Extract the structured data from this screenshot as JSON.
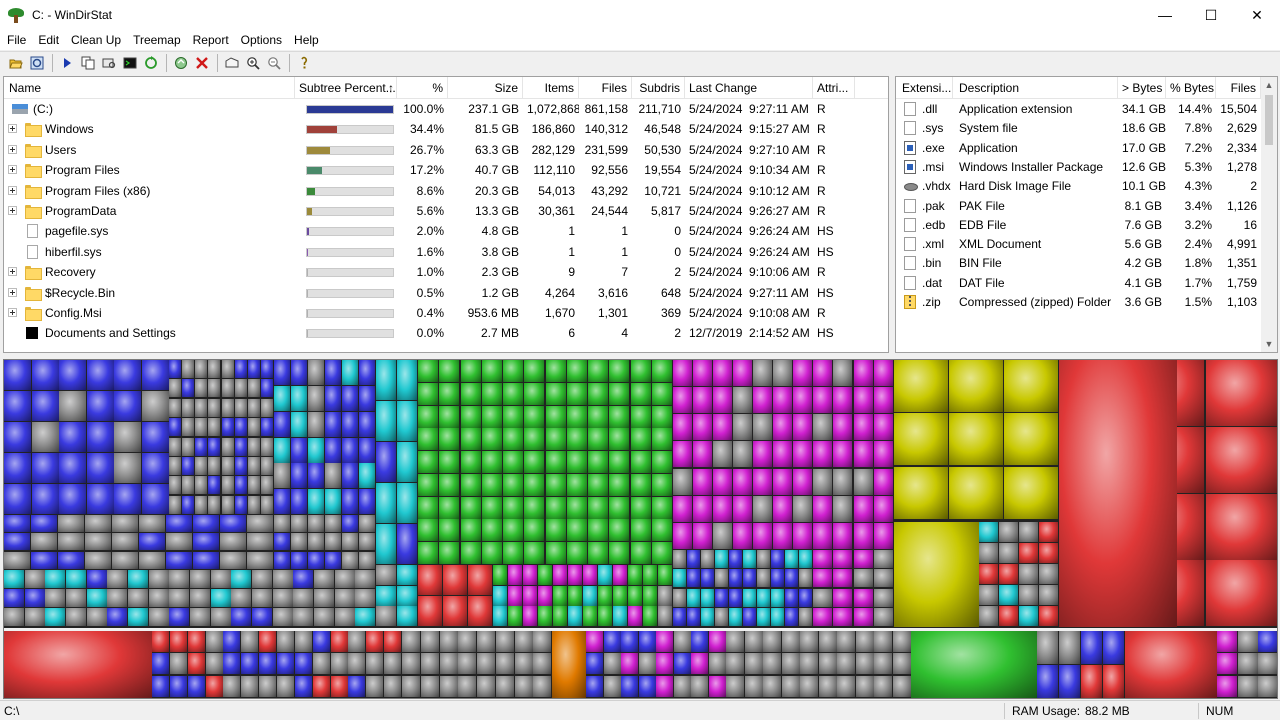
{
  "window": {
    "title": "C: - WinDirStat",
    "minimize_glyph": "—",
    "maximize_glyph": "☐",
    "close_glyph": "✕"
  },
  "menu": [
    "File",
    "Edit",
    "Clean Up",
    "Treemap",
    "Report",
    "Options",
    "Help"
  ],
  "toolbar": {
    "icons": [
      "open-folder-icon",
      "refresh-all-icon",
      "play-icon",
      "copy-path-icon",
      "explorer-icon",
      "command-prompt-icon",
      "refresh-icon",
      "recycle-icon",
      "delete-icon",
      "properties-icon",
      "zoom-in-icon",
      "zoom-out-icon",
      "help-icon"
    ]
  },
  "directory_list": {
    "columns": {
      "name": "Name",
      "subtree": "Subtree Percent...",
      "sort_indicator": "↑",
      "percent": "%",
      "size": "Size",
      "items": "Items",
      "files": "Files",
      "subdirs": "Subdris",
      "last_change": "Last Change",
      "attributes": "Attri..."
    },
    "rows": [
      {
        "name": "(C:)",
        "icon": "drive-icon",
        "expandable": false,
        "subtree_pct": 100.0,
        "bar_color": "#2a3a94",
        "pct": "100.0%",
        "size": "237.1 GB",
        "items": "1,072,868",
        "files": "861,158",
        "subdirs": "211,710",
        "last_change": "5/24/2024  9:27:11 AM",
        "attr": "R"
      },
      {
        "name": "Windows",
        "icon": "folder-icon",
        "expandable": true,
        "subtree_pct": 34.4,
        "bar_color": "#a0413a",
        "pct": "34.4%",
        "size": "81.5 GB",
        "items": "186,860",
        "files": "140,312",
        "subdirs": "46,548",
        "last_change": "5/24/2024  9:15:27 AM",
        "attr": "R"
      },
      {
        "name": "Users",
        "icon": "folder-icon",
        "expandable": true,
        "subtree_pct": 26.7,
        "bar_color": "#9e8a3c",
        "pct": "26.7%",
        "size": "63.3 GB",
        "items": "282,129",
        "files": "231,599",
        "subdirs": "50,530",
        "last_change": "5/24/2024  9:27:10 AM",
        "attr": "R"
      },
      {
        "name": "Program Files",
        "icon": "folder-icon",
        "expandable": true,
        "subtree_pct": 17.2,
        "bar_color": "#4a8a6a",
        "pct": "17.2%",
        "size": "40.7 GB",
        "items": "112,110",
        "files": "92,556",
        "subdirs": "19,554",
        "last_change": "5/24/2024  9:10:34 AM",
        "attr": "R"
      },
      {
        "name": "Program Files (x86)",
        "icon": "folder-icon",
        "expandable": true,
        "subtree_pct": 8.6,
        "bar_color": "#3a8a3a",
        "pct": "8.6%",
        "size": "20.3 GB",
        "items": "54,013",
        "files": "43,292",
        "subdirs": "10,721",
        "last_change": "5/24/2024  9:10:12 AM",
        "attr": "R"
      },
      {
        "name": "ProgramData",
        "icon": "folder-icon",
        "expandable": true,
        "subtree_pct": 5.6,
        "bar_color": "#9a8a3a",
        "pct": "5.6%",
        "size": "13.3 GB",
        "items": "30,361",
        "files": "24,544",
        "subdirs": "5,817",
        "last_change": "5/24/2024  9:26:27 AM",
        "attr": "R"
      },
      {
        "name": "pagefile.sys",
        "icon": "file-icon",
        "expandable": false,
        "subtree_pct": 2.0,
        "bar_color": "#6a4aa0",
        "pct": "2.0%",
        "size": "4.8 GB",
        "items": "1",
        "files": "1",
        "subdirs": "0",
        "last_change": "5/24/2024  9:26:24 AM",
        "attr": "HS"
      },
      {
        "name": "hiberfil.sys",
        "icon": "file-icon",
        "expandable": false,
        "subtree_pct": 1.6,
        "bar_color": "#8a5ab0",
        "pct": "1.6%",
        "size": "3.8 GB",
        "items": "1",
        "files": "1",
        "subdirs": "0",
        "last_change": "5/24/2024  9:26:24 AM",
        "attr": "HS"
      },
      {
        "name": "Recovery",
        "icon": "folder-icon",
        "expandable": true,
        "subtree_pct": 1.0,
        "bar_color": "#b0b0b0",
        "pct": "1.0%",
        "size": "2.3 GB",
        "items": "9",
        "files": "7",
        "subdirs": "2",
        "last_change": "5/24/2024  9:10:06 AM",
        "attr": "R"
      },
      {
        "name": "$Recycle.Bin",
        "icon": "folder-icon",
        "expandable": true,
        "subtree_pct": 0.5,
        "bar_color": "#b0b0b0",
        "pct": "0.5%",
        "size": "1.2 GB",
        "items": "4,264",
        "files": "3,616",
        "subdirs": "648",
        "last_change": "5/24/2024  9:27:11 AM",
        "attr": "HS"
      },
      {
        "name": "Config.Msi",
        "icon": "folder-icon",
        "expandable": true,
        "subtree_pct": 0.4,
        "bar_color": "#b0b0b0",
        "pct": "0.4%",
        "size": "953.6 MB",
        "items": "1,670",
        "files": "1,301",
        "subdirs": "369",
        "last_change": "5/24/2024  9:10:08 AM",
        "attr": "R"
      },
      {
        "name": "Documents and Settings",
        "icon": "black-icon",
        "expandable": false,
        "subtree_pct": 0.0,
        "bar_color": "#b0b0b0",
        "pct": "0.0%",
        "size": "2.7 MB",
        "items": "6",
        "files": "4",
        "subdirs": "2",
        "last_change": "12/7/2019  2:14:52 AM",
        "attr": "HS"
      }
    ]
  },
  "extension_list": {
    "columns": {
      "extension": "Extensi...",
      "description": "Description",
      "bytes": "> Bytes",
      "pct_bytes": "% Bytes",
      "files": "Files"
    },
    "rows": [
      {
        "ext": ".dll",
        "icon": "generic",
        "desc": "Application extension",
        "bytes": "34.1 GB",
        "pct": "14.4%",
        "files": "15,504"
      },
      {
        "ext": ".sys",
        "icon": "generic",
        "desc": "System file",
        "bytes": "18.6 GB",
        "pct": "7.8%",
        "files": "2,629"
      },
      {
        "ext": ".exe",
        "icon": "app",
        "desc": "Application",
        "bytes": "17.0 GB",
        "pct": "7.2%",
        "files": "2,334"
      },
      {
        "ext": ".msi",
        "icon": "app",
        "desc": "Windows Installer Package",
        "bytes": "12.6 GB",
        "pct": "5.3%",
        "files": "1,278"
      },
      {
        "ext": ".vhdx",
        "icon": "disk",
        "desc": "Hard Disk Image File",
        "bytes": "10.1 GB",
        "pct": "4.3%",
        "files": "2"
      },
      {
        "ext": ".pak",
        "icon": "generic",
        "desc": "PAK File",
        "bytes": "8.1 GB",
        "pct": "3.4%",
        "files": "1,126"
      },
      {
        "ext": ".edb",
        "icon": "generic",
        "desc": "EDB File",
        "bytes": "7.6 GB",
        "pct": "3.2%",
        "files": "16"
      },
      {
        "ext": ".xml",
        "icon": "generic",
        "desc": "XML Document",
        "bytes": "5.6 GB",
        "pct": "2.4%",
        "files": "4,991"
      },
      {
        "ext": ".bin",
        "icon": "generic",
        "desc": "BIN File",
        "bytes": "4.2 GB",
        "pct": "1.8%",
        "files": "1,351"
      },
      {
        "ext": ".dat",
        "icon": "generic",
        "desc": "DAT File",
        "bytes": "4.1 GB",
        "pct": "1.7%",
        "files": "1,759"
      },
      {
        "ext": ".zip",
        "icon": "zip",
        "desc": "Compressed (zipped) Folder",
        "bytes": "3.6 GB",
        "pct": "1.5%",
        "files": "1,103"
      }
    ]
  },
  "treemap": {
    "colors": [
      "#3a3ae0",
      "#30c030",
      "#d020d0",
      "#c8c800",
      "#e03838",
      "#20c8d0",
      "#909090",
      "#e07a00"
    ]
  },
  "statusbar": {
    "path": "C:\\",
    "ram_label": "RAM Usage:",
    "ram_value": "88.2 MB",
    "num": "NUM"
  }
}
